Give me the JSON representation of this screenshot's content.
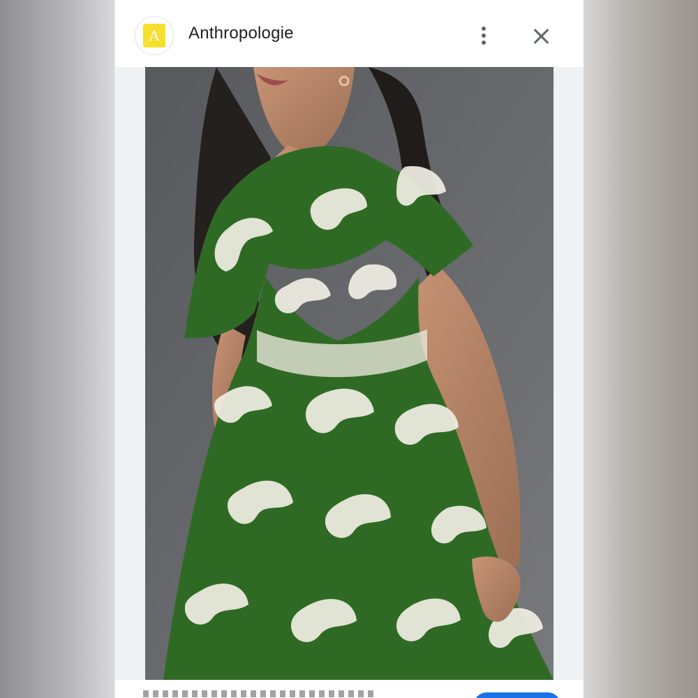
{
  "app": {
    "title": "Anthropologie",
    "badge_letter": "A",
    "icons": {
      "badge": "anthropologie-logo",
      "menu": "more-vert-icon",
      "close": "close-icon"
    },
    "colors": {
      "badge": "#f6df2d",
      "dress_green": "#2f6a25",
      "backdrop": "#66676a",
      "button": "#1a73e8"
    }
  }
}
